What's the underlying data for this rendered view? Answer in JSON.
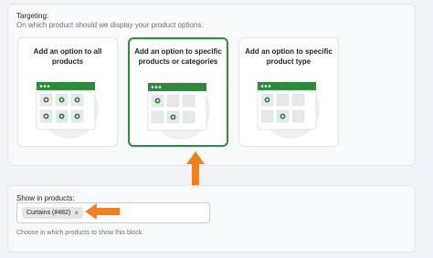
{
  "targeting": {
    "label": "Targeting:",
    "help": "On which product should we display your product options.",
    "options": [
      {
        "title": "Add an option to all products",
        "selected": false
      },
      {
        "title": "Add an option to specific products or categories",
        "selected": true
      },
      {
        "title": "Add an option to specific product type",
        "selected": false
      }
    ]
  },
  "show_in_products": {
    "label": "Show in products:",
    "tag": "Curtains (#482)",
    "tag_remove": "×",
    "help": "Choose in which products to show this block."
  },
  "colors": {
    "accent_green": "#2f8a3d",
    "arrow_orange": "#f47f1e"
  }
}
